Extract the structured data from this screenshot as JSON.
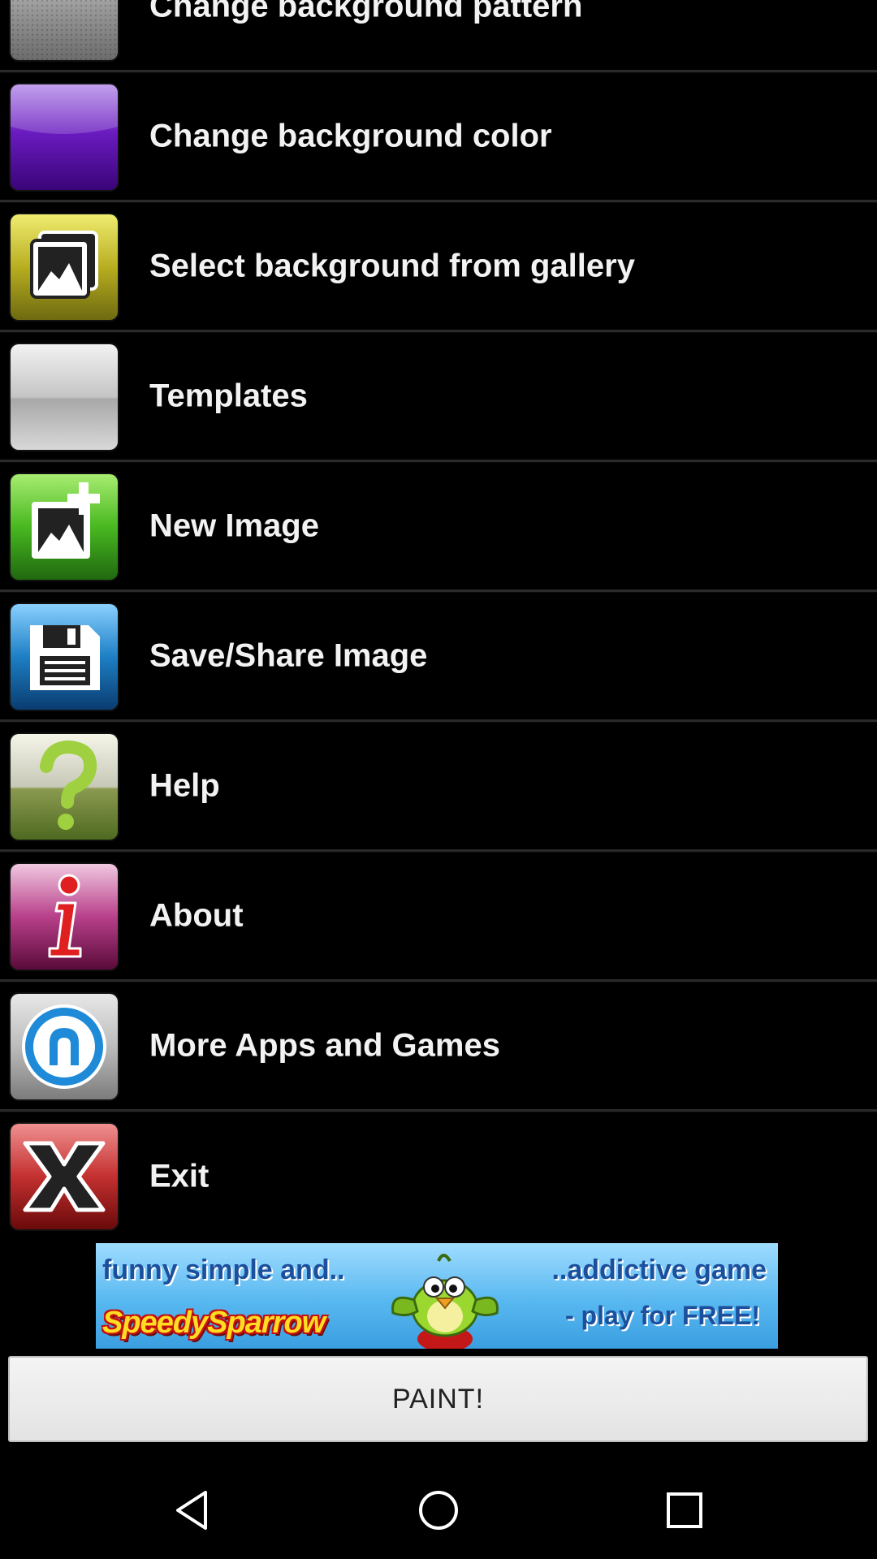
{
  "menu": {
    "items": [
      {
        "label": "Change background pattern",
        "icon": "pattern-icon"
      },
      {
        "label": "Change background color",
        "icon": "color-swatch-icon"
      },
      {
        "label": "Select background from gallery",
        "icon": "gallery-icon"
      },
      {
        "label": "Templates",
        "icon": "templates-icon"
      },
      {
        "label": "New Image",
        "icon": "new-image-icon"
      },
      {
        "label": "Save/Share Image",
        "icon": "floppy-disk-icon"
      },
      {
        "label": "Help",
        "icon": "question-mark-icon"
      },
      {
        "label": "About",
        "icon": "info-icon"
      },
      {
        "label": "More Apps and Games",
        "icon": "more-apps-icon"
      },
      {
        "label": "Exit",
        "icon": "exit-x-icon"
      }
    ]
  },
  "ad": {
    "top_left": "funny simple and..",
    "top_right": "..addictive game",
    "logo": "SpeedySparrow",
    "bottom_right": "- play for FREE!"
  },
  "paint_button": {
    "label": "PAINT!"
  },
  "colors": {
    "background": "#000000",
    "divider": "#2a2a2a",
    "purple_swatch": "#5a10a8",
    "gallery_yellow": "#b0a820",
    "new_image_green": "#3ea820",
    "save_blue": "#1d7fc4",
    "help_green": "#7a9a40",
    "about_magenta": "#b0306e",
    "exit_red": "#c43030"
  },
  "navbar": {
    "back": "back-icon",
    "home": "home-icon",
    "recent": "recent-apps-icon"
  }
}
